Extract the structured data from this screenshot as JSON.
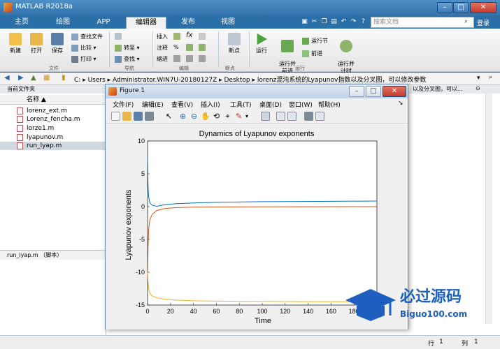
{
  "app": {
    "title": "MATLAB R2018a"
  },
  "window_controls": {
    "minimize": "–",
    "maximize": "□",
    "close": "✕"
  },
  "tabs": [
    {
      "label": "主页"
    },
    {
      "label": "绘图"
    },
    {
      "label": "APP"
    },
    {
      "label": "编辑器"
    },
    {
      "label": "发布"
    },
    {
      "label": "视图"
    }
  ],
  "search": {
    "placeholder": "搜索文档"
  },
  "signin_label": "登录",
  "toolstrip": {
    "file": {
      "new": "新建",
      "open": "打开",
      "save": "保存",
      "find_files": "查找文件",
      "compare": "比较",
      "print": "打印",
      "group": "文件"
    },
    "nav": {
      "goto": "转至",
      "find": "查找",
      "group": "导航"
    },
    "edit": {
      "insert": "插入",
      "comment": "注释",
      "indent": "缩进",
      "fx": "fx",
      "pct": "%",
      "group": "编辑"
    },
    "breakpoints": {
      "label": "断点",
      "group": "断点"
    },
    "run": {
      "run": "运行",
      "run_advance": "运行并\n前进",
      "run_section": "运行节",
      "advance": "前进",
      "run_time": "运行并\n计时",
      "group": "运行"
    }
  },
  "address": {
    "segments": [
      "C:",
      "Users",
      "Administrator.WIN7U-20180127Z",
      "Desktop",
      "lorenz混沌系统的Lyapunov指数以及分叉图，可以修改参数"
    ]
  },
  "left_panel": {
    "title": "当前文件夹",
    "column_header": "名称 ▲",
    "files": [
      "lorenz_ext.m",
      "Lorenz_fencha.m",
      "lorze1.m",
      "lyapunov.m",
      "run_lyap.m"
    ],
    "selected_index": 4,
    "detail": "run_lyap.m  （脚本）"
  },
  "right_panel": {
    "title": "以及分叉图，可以..."
  },
  "status": {
    "row_label": "行",
    "row": "1",
    "col_label": "列",
    "col": "1"
  },
  "figure": {
    "title": "Figure 1",
    "menu": [
      "文件(F)",
      "编辑(E)",
      "查看(V)",
      "插入(I)",
      "工具(T)",
      "桌面(D)",
      "窗口(W)",
      "帮助(H)"
    ]
  },
  "watermark": {
    "cn": "必过源码",
    "url": "Biguo100.com"
  },
  "chart_data": {
    "type": "line",
    "title": "Dynamics of Lyapunov exponents",
    "xlabel": "Time",
    "ylabel": "Lyapunov exponents",
    "xlim": [
      0,
      200
    ],
    "ylim": [
      -15,
      10
    ],
    "xticks": [
      0,
      20,
      40,
      60,
      80,
      100,
      120,
      140,
      160,
      180
    ],
    "yticks": [
      -15,
      -10,
      -5,
      0,
      5,
      10
    ],
    "grid": false,
    "series": [
      {
        "color": "#0072bd",
        "x": [
          0,
          0.5,
          1,
          2,
          4,
          8,
          15,
          25,
          40,
          60,
          100,
          150,
          200
        ],
        "y": [
          7.5,
          3.0,
          1.5,
          0.6,
          0.2,
          0.05,
          0.3,
          0.45,
          0.55,
          0.65,
          0.75,
          0.8,
          0.85
        ]
      },
      {
        "color": "#d95319",
        "x": [
          0,
          0.5,
          1,
          2,
          4,
          8,
          15,
          25,
          40,
          60,
          100,
          150,
          200
        ],
        "y": [
          -11.0,
          -6.0,
          -3.5,
          -2.0,
          -1.2,
          -0.6,
          -0.3,
          -0.15,
          -0.08,
          -0.05,
          -0.02,
          -0.01,
          0.0
        ]
      },
      {
        "color": "#edb120",
        "x": [
          0,
          0.5,
          1,
          2,
          4,
          8,
          15,
          25,
          40,
          60,
          100,
          150,
          200
        ],
        "y": [
          -10.0,
          -11.5,
          -12.5,
          -13.2,
          -13.6,
          -13.9,
          -14.1,
          -14.25,
          -14.35,
          -14.4,
          -14.45,
          -14.5,
          -14.5
        ]
      }
    ]
  }
}
